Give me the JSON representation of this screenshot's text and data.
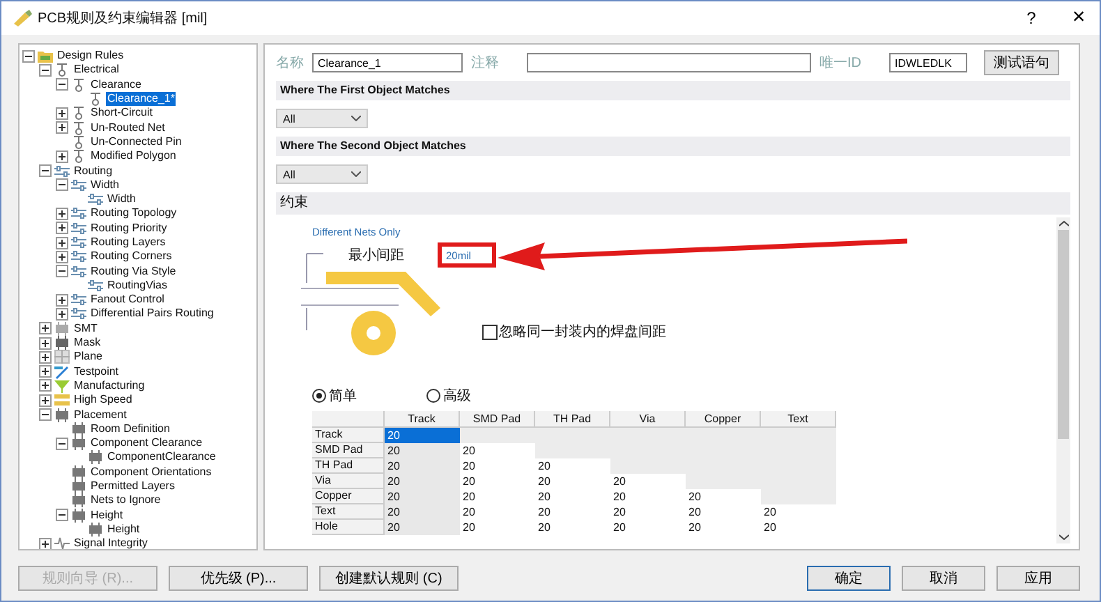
{
  "window": {
    "title": "PCB规则及约束编辑器 [mil]",
    "help": "?",
    "close": "×"
  },
  "tree": [
    {
      "label": "Design Rules",
      "kind": "folder",
      "expanded": true,
      "selected": false,
      "children": [
        {
          "label": "Electrical",
          "kind": "electrical",
          "expanded": true,
          "selected": false,
          "children": [
            {
              "label": "Clearance",
              "kind": "electrical",
              "expanded": true,
              "selected": false,
              "children": [
                {
                  "label": "Clearance_1*",
                  "kind": "electrical",
                  "selected": true
                }
              ]
            },
            {
              "label": "Short-Circuit",
              "kind": "electrical",
              "expanded": false,
              "selected": false
            },
            {
              "label": "Un-Routed Net",
              "kind": "electrical",
              "expanded": false,
              "selected": false
            },
            {
              "label": "Un-Connected Pin",
              "kind": "electrical",
              "selected": false
            },
            {
              "label": "Modified Polygon",
              "kind": "electrical",
              "expanded": false,
              "selected": false
            }
          ]
        },
        {
          "label": "Routing",
          "kind": "routing",
          "expanded": true,
          "selected": false,
          "children": [
            {
              "label": "Width",
              "kind": "routing",
              "expanded": true,
              "selected": false,
              "children": [
                {
                  "label": "Width",
                  "kind": "routing",
                  "selected": false
                }
              ]
            },
            {
              "label": "Routing Topology",
              "kind": "routing",
              "expanded": false,
              "selected": false
            },
            {
              "label": "Routing Priority",
              "kind": "routing",
              "expanded": false,
              "selected": false
            },
            {
              "label": "Routing Layers",
              "kind": "routing",
              "expanded": false,
              "selected": false
            },
            {
              "label": "Routing Corners",
              "kind": "routing",
              "expanded": false,
              "selected": false
            },
            {
              "label": "Routing Via Style",
              "kind": "routing",
              "expanded": true,
              "selected": false,
              "children": [
                {
                  "label": "RoutingVias",
                  "kind": "routing",
                  "selected": false
                }
              ]
            },
            {
              "label": "Fanout Control",
              "kind": "routing",
              "expanded": false,
              "selected": false
            },
            {
              "label": "Differential Pairs Routing",
              "kind": "routing",
              "expanded": false,
              "selected": false
            }
          ]
        },
        {
          "label": "SMT",
          "kind": "smt",
          "expanded": false,
          "selected": false
        },
        {
          "label": "Mask",
          "kind": "mask",
          "expanded": false,
          "selected": false
        },
        {
          "label": "Plane",
          "kind": "plane",
          "expanded": false,
          "selected": false
        },
        {
          "label": "Testpoint",
          "kind": "testpoint",
          "expanded": false,
          "selected": false
        },
        {
          "label": "Manufacturing",
          "kind": "manufacturing",
          "expanded": false,
          "selected": false
        },
        {
          "label": "High Speed",
          "kind": "highspeed",
          "expanded": false,
          "selected": false
        },
        {
          "label": "Placement",
          "kind": "placement",
          "expanded": true,
          "selected": false,
          "children": [
            {
              "label": "Room Definition",
              "kind": "placement",
              "selected": false
            },
            {
              "label": "Component Clearance",
              "kind": "placement",
              "expanded": true,
              "selected": false,
              "children": [
                {
                  "label": "ComponentClearance",
                  "kind": "placement",
                  "selected": false
                }
              ]
            },
            {
              "label": "Component Orientations",
              "kind": "placement",
              "selected": false
            },
            {
              "label": "Permitted Layers",
              "kind": "placement",
              "selected": false
            },
            {
              "label": "Nets to Ignore",
              "kind": "placement",
              "selected": false
            },
            {
              "label": "Height",
              "kind": "placement",
              "expanded": true,
              "selected": false,
              "children": [
                {
                  "label": "Height",
                  "kind": "placement",
                  "selected": false
                }
              ]
            }
          ]
        },
        {
          "label": "Signal Integrity",
          "kind": "signal",
          "expanded": false,
          "selected": false
        }
      ]
    }
  ],
  "rule": {
    "name_label": "名称",
    "name": "Clearance_1",
    "comment_label": "注释",
    "id_label": "唯一ID",
    "id": "IDWLEDLK",
    "test_button": "测试语句"
  },
  "first_match": {
    "title": "Where The First Object Matches",
    "value": "All"
  },
  "second_match": {
    "title": "Where The Second Object Matches",
    "value": "All"
  },
  "constraints": {
    "title": "约束",
    "net_scope": "Different Nets Only",
    "min_clearance_label": "最小间距",
    "min_clearance": "20mil",
    "ignore_pads": {
      "label": "忽略同一封装内的焊盘间距",
      "checked": false
    },
    "modes": [
      {
        "label": "简单",
        "selected": true
      },
      {
        "label": "高级",
        "selected": false
      }
    ],
    "table": {
      "columns": [
        "Track",
        "SMD Pad",
        "TH Pad",
        "Via",
        "Copper",
        "Text"
      ],
      "rows": [
        {
          "label": "Track",
          "cells": [
            {
              "value": "20",
              "selected": true
            }
          ]
        },
        {
          "label": "SMD Pad",
          "cells": [
            {
              "value": "20",
              "selected": false
            },
            {
              "value": "20",
              "selected": false
            }
          ]
        },
        {
          "label": "TH Pad",
          "cells": [
            {
              "value": "20",
              "selected": false
            },
            {
              "value": "20",
              "selected": false
            },
            {
              "value": "20",
              "selected": false
            }
          ]
        },
        {
          "label": "Via",
          "cells": [
            {
              "value": "20",
              "selected": false
            },
            {
              "value": "20",
              "selected": false
            },
            {
              "value": "20",
              "selected": false
            },
            {
              "value": "20",
              "selected": false
            }
          ]
        },
        {
          "label": "Copper",
          "cells": [
            {
              "value": "20",
              "selected": false
            },
            {
              "value": "20",
              "selected": false
            },
            {
              "value": "20",
              "selected": false
            },
            {
              "value": "20",
              "selected": false
            },
            {
              "value": "20",
              "selected": false
            }
          ]
        },
        {
          "label": "Text",
          "cells": [
            {
              "value": "20",
              "selected": false
            },
            {
              "value": "20",
              "selected": false
            },
            {
              "value": "20",
              "selected": false
            },
            {
              "value": "20",
              "selected": false
            },
            {
              "value": "20",
              "selected": false
            },
            {
              "value": "20",
              "selected": false
            }
          ]
        },
        {
          "label": "Hole",
          "cells": [
            {
              "value": "20",
              "selected": false
            },
            {
              "value": "20",
              "selected": false
            },
            {
              "value": "20",
              "selected": false
            },
            {
              "value": "20",
              "selected": false
            },
            {
              "value": "20",
              "selected": false
            },
            {
              "value": "20",
              "selected": false
            }
          ]
        }
      ]
    }
  },
  "buttons": [
    {
      "label": "规则向导 (R)...",
      "disabled": true
    },
    {
      "label": "优先级 (P)...",
      "disabled": false
    },
    {
      "label": "创建默认规则 (C)",
      "disabled": false
    }
  ],
  "dialog_buttons": [
    {
      "label": "确定",
      "default": true
    },
    {
      "label": "取消",
      "default": false
    },
    {
      "label": "应用",
      "default": false
    }
  ]
}
